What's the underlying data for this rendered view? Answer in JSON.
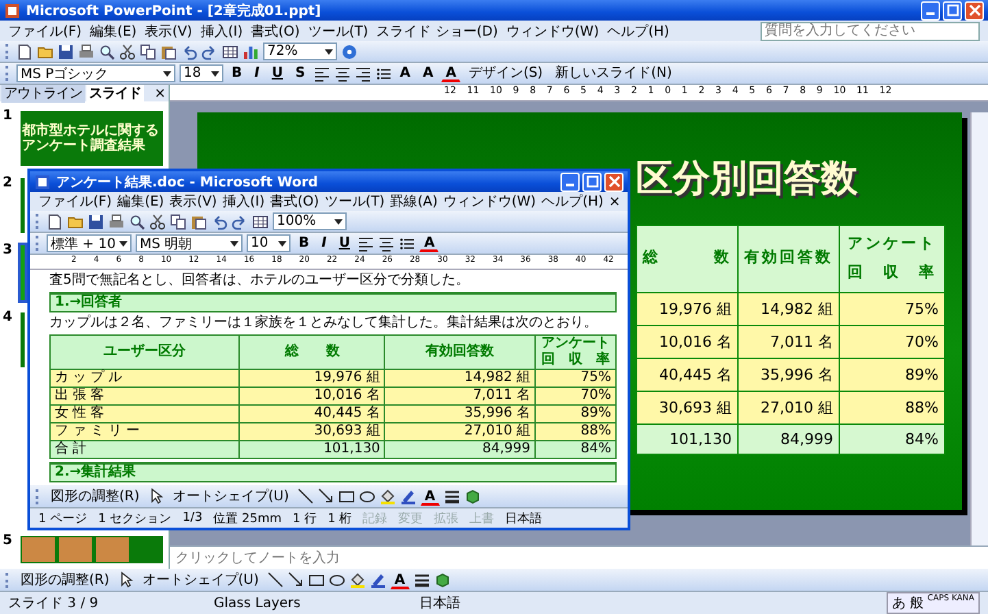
{
  "window": {
    "title": "Microsoft PowerPoint - [2章完成01.ppt]"
  },
  "menu": [
    "ファイル(F)",
    "編集(E)",
    "表示(V)",
    "挿入(I)",
    "書式(O)",
    "ツール(T)",
    "スライド ショー(D)",
    "ウィンドウ(W)",
    "ヘルプ(H)"
  ],
  "help_field": {
    "placeholder": "質問を入力してください"
  },
  "standard_toolbar": {
    "zoom": "72%"
  },
  "format_toolbar": {
    "font": "MS Pゴシック",
    "size": "18",
    "buttons": [
      "B",
      "I",
      "U",
      "S"
    ],
    "size_buttons": [
      "A",
      "A"
    ],
    "font_color": "A",
    "design": "デザイン(S)",
    "new_slide": "新しいスライド(N)"
  },
  "pane_tabs": [
    {
      "label": "アウトライン",
      "selected": false
    },
    {
      "label": "スライド",
      "selected": true
    }
  ],
  "pane_close": "×",
  "ruler": [
    "12",
    "11",
    "10",
    "9",
    "8",
    "7",
    "6",
    "5",
    "4",
    "3",
    "2",
    "1",
    "0",
    "1",
    "2",
    "3",
    "4",
    "5",
    "6",
    "7",
    "8",
    "9",
    "10",
    "11",
    "12"
  ],
  "thumbnails": [
    {
      "number": "1",
      "selected": false,
      "kind": "title",
      "title": "都市型ホテルに関するアンケート調査結果"
    },
    {
      "number": "2",
      "selected": false,
      "kind": "plain"
    },
    {
      "number": "3",
      "selected": true,
      "kind": "plain"
    },
    {
      "number": "4",
      "selected": false,
      "kind": "plain"
    },
    {
      "number": "5",
      "selected": false,
      "kind": "photos"
    }
  ],
  "slide": {
    "title": "区分別回答数",
    "columns": [
      "総　　　数",
      "有効回答数",
      "アンケート回　収　率"
    ],
    "rows": [
      {
        "kind": "data",
        "cells": [
          "19,976 組",
          "14,982 組",
          "75%"
        ]
      },
      {
        "kind": "data",
        "cells": [
          "10,016 名",
          "7,011 名",
          "70%"
        ]
      },
      {
        "kind": "data",
        "cells": [
          "40,445 名",
          "35,996 名",
          "89%"
        ]
      },
      {
        "kind": "data",
        "cells": [
          "30,693 組",
          "27,010 組",
          "88%"
        ]
      },
      {
        "kind": "total",
        "cells": [
          "101,130",
          "84,999",
          "84%"
        ]
      }
    ]
  },
  "notes": {
    "placeholder": "クリックしてノートを入力"
  },
  "drawing_toolbar": {
    "adjust": "図形の調整(R)",
    "autoshape": "オートシェイプ(U)",
    "font_color": "A"
  },
  "status_bar": [
    "スライド 3 / 9",
    "Glass Layers",
    "日本語"
  ],
  "ime_bar": [
    "あ",
    "般",
    "CAPS KANA"
  ],
  "word": {
    "title": "アンケート結果.doc - Microsoft Word",
    "menu": [
      "ファイル(F)",
      "編集(E)",
      "表示(V)",
      "挿入(I)",
      "書式(O)",
      "ツール(T)",
      "罫線(A)",
      "ウィンドウ(W)",
      "ヘルプ(H)"
    ],
    "menu_close": "×",
    "zoom": "100%",
    "style": "標準 + 10",
    "font": "MS 明朝",
    "size": "10",
    "buttons": [
      "B",
      "I",
      "U"
    ],
    "font_color": "A",
    "ruler": [
      "2",
      "4",
      "6",
      "8",
      "10",
      "12",
      "14",
      "16",
      "18",
      "20",
      "22",
      "24",
      "26",
      "28",
      "30",
      "32",
      "34",
      "36",
      "38",
      "40",
      "42"
    ],
    "document": [
      {
        "kind": "text",
        "text": "査5問で無記名とし、回答者は、ホテルのユーザー区分で分類した。"
      },
      {
        "kind": "heading",
        "text": "1.→回答者"
      },
      {
        "kind": "text",
        "text": "カップルは２名、ファミリーは１家族を１とみなして集計した。集計結果は次のとおり。"
      },
      {
        "kind": "table",
        "columns": [
          "ユーザー区分",
          "総　　数",
          "有効回答数",
          "アンケート回　収　率"
        ],
        "rows": [
          {
            "kind": "data",
            "cells": [
              "カップル",
              "19,976 組",
              "14,982 組",
              "75%"
            ]
          },
          {
            "kind": "data",
            "cells": [
              "出張客",
              "10,016 名",
              "7,011 名",
              "70%"
            ]
          },
          {
            "kind": "data",
            "cells": [
              "女性客",
              "40,445 名",
              "35,996 名",
              "89%"
            ]
          },
          {
            "kind": "data",
            "cells": [
              "ファミリー",
              "30,693 組",
              "27,010 組",
              "88%"
            ]
          },
          {
            "kind": "total",
            "cells": [
              "合計",
              "101,130",
              "84,999",
              "84%"
            ]
          }
        ]
      },
      {
        "kind": "heading",
        "text": "2.→集計結果"
      }
    ],
    "drawing_toolbar": {
      "adjust": "図形の調整(R)",
      "autoshape": "オートシェイプ(U)",
      "font_color": "A"
    },
    "status_bar": [
      {
        "text": "1 ページ",
        "disabled": false
      },
      {
        "text": "1 セクション",
        "disabled": false
      },
      {
        "text": "1/3",
        "disabled": false
      },
      {
        "text": "位置 25mm",
        "disabled": false
      },
      {
        "text": "1 行",
        "disabled": false
      },
      {
        "text": "1 桁",
        "disabled": false
      },
      {
        "text": "記録",
        "disabled": true
      },
      {
        "text": "変更",
        "disabled": true
      },
      {
        "text": "拡張",
        "disabled": true
      },
      {
        "text": "上書",
        "disabled": true
      },
      {
        "text": "日本語",
        "disabled": false
      }
    ]
  }
}
